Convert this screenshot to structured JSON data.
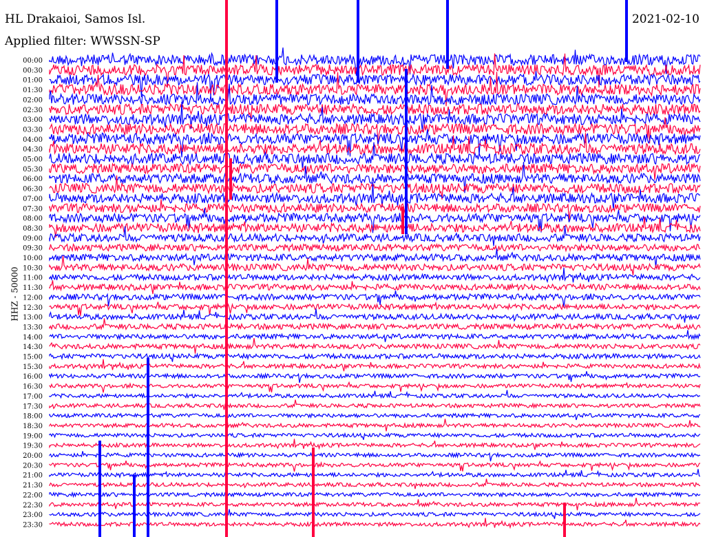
{
  "header": {
    "station": "HL Drakaioi, Samos Isl.",
    "filter": "Applied filter: WWSSN-SP",
    "date": "2021-02-10"
  },
  "chart_data": {
    "type": "line",
    "title": "HL Drakaioi, Samos Isl.",
    "subtitle": "Applied filter: WWSSN-SP",
    "date": "2021-02-10",
    "ylabel": "HHZ - 50000",
    "colors": [
      "#0000ff",
      "#ff0040"
    ],
    "categories": [
      "00:00",
      "00:30",
      "01:00",
      "01:30",
      "02:00",
      "02:30",
      "03:00",
      "03:30",
      "04:00",
      "04:30",
      "05:00",
      "05:30",
      "06:00",
      "06:30",
      "07:00",
      "07:30",
      "08:00",
      "08:30",
      "09:00",
      "09:30",
      "10:00",
      "10:30",
      "11:00",
      "11:30",
      "12:00",
      "12:30",
      "13:00",
      "13:30",
      "14:00",
      "14:30",
      "15:00",
      "15:30",
      "16:00",
      "16:30",
      "17:00",
      "17:30",
      "18:00",
      "18:30",
      "19:00",
      "19:30",
      "20:00",
      "20:30",
      "21:00",
      "21:30",
      "22:00",
      "22:30",
      "23:00",
      "23:30"
    ],
    "noise_level": [
      0.55,
      0.55,
      0.55,
      0.55,
      0.55,
      0.55,
      0.55,
      0.55,
      0.55,
      0.55,
      0.55,
      0.5,
      0.5,
      0.5,
      0.5,
      0.45,
      0.45,
      0.45,
      0.4,
      0.35,
      0.35,
      0.35,
      0.3,
      0.3,
      0.3,
      0.28,
      0.28,
      0.28,
      0.25,
      0.25,
      0.25,
      0.22,
      0.22,
      0.2,
      0.2,
      0.2,
      0.2,
      0.2,
      0.2,
      0.2,
      0.2,
      0.2,
      0.2,
      0.2,
      0.2,
      0.2,
      0.2,
      0.2
    ]
  }
}
